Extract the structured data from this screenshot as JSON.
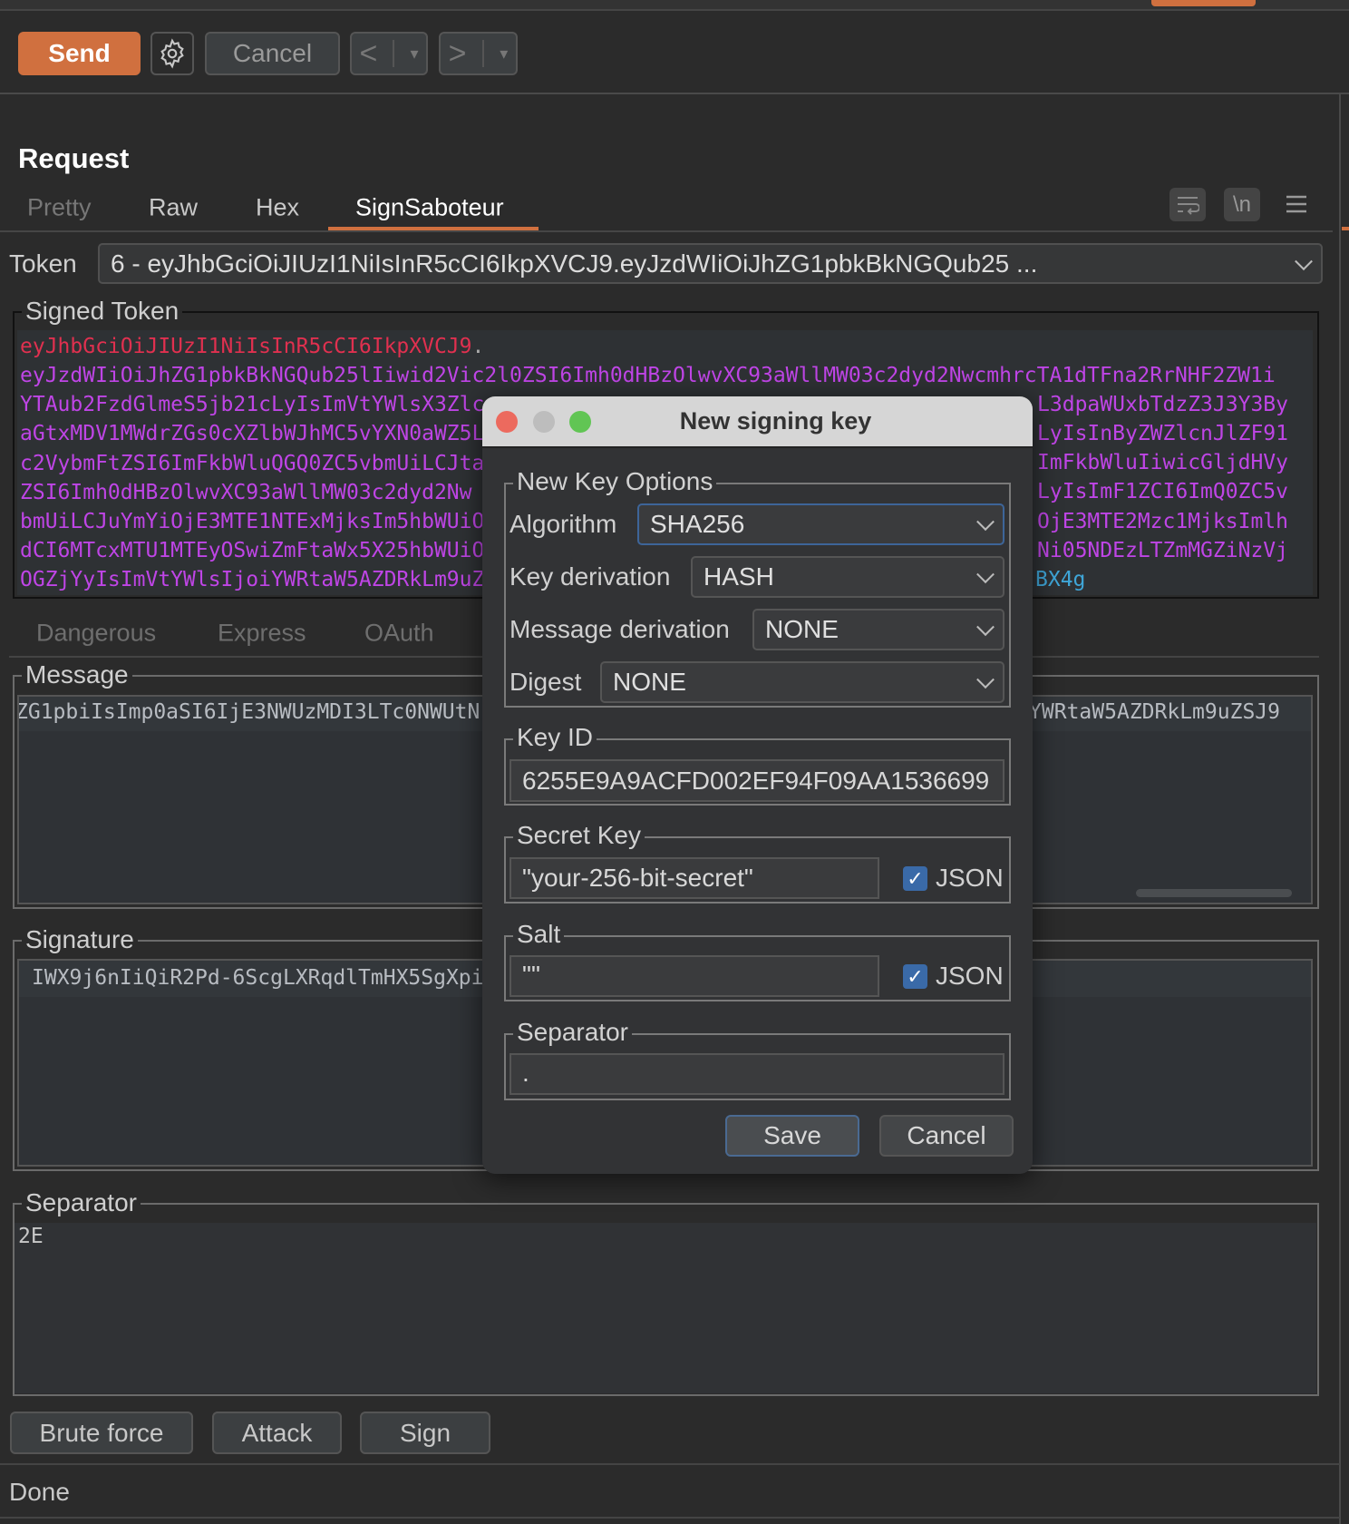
{
  "colors": {
    "accent": "#d0703f",
    "header": "#e0304f",
    "payload": "#bf45e6",
    "signature": "#3fa6d8"
  },
  "toolbar": {
    "send": "Send",
    "cancel": "Cancel",
    "back": "<",
    "forward": ">",
    "dropdown": "▾"
  },
  "request": {
    "title": "Request",
    "tabs": [
      "Pretty",
      "Raw",
      "Hex",
      "SignSaboteur"
    ],
    "active_tab": "SignSaboteur",
    "icons": {
      "wrap": "wrap-icon",
      "newline": "\\n",
      "menu": "menu-icon"
    }
  },
  "token": {
    "label": "Token",
    "value": "6 - eyJhbGciOiJIUzI1NiIsInR5cCI6IkpXVCJ9.eyJzdWIiOiJhZG1pbkBkNGQub25 ..."
  },
  "signed_token": {
    "legend": "Signed Token",
    "line1": "eyJhbGciOiJIUzI1NiIsInR5cCI6IkpXVCJ9",
    "dot": ".",
    "line2": "eyJzdWIiOiJhZG1pbkBkNGQub25lIiwid2Vic2l0ZSI6Imh0dHBzOlwvXC93aWllMW03c2dyd2NwcmhrcTA1dTFna2RrNHF2ZW1i",
    "left": [
      "YTAub2FzdGlmeS5jb21cLyIsImVtYWlsX3Zlc",
      "aGtxMDV1MWdrZGs0cXZlbWJhMC5vYXN0aWZ5L",
      "c2VybmFtZSI6ImFkbWluQGQ0ZC5vbmUiLCJta",
      "ZSI6Imh0dHBzOlwvXC93aWllMW03c2dyd2Nw",
      "bmUiLCJuYmYiOjE3MTE1NTExMjksIm5hbWUiO",
      "dCI6MTcxMTU1MTEyOSwiZmFtaWx5X25hbWUiO",
      "OGZjYyIsImVtYWlsIjoiYWRtaW5AZDRkLm9uZ"
    ],
    "right": [
      "L3dpaWUxbTdzZ3J3Y3By",
      "LyIsInByZWZlcnJlZF91",
      "ImFkbWluIiwicGljdHVy",
      "LyIsImF1ZCI6ImQ0ZC5v",
      "OjE3MTE2Mzc1MjksImlh",
      "Ni05NDEzLTZmMGZiNzVj"
    ],
    "signature_tail": "BX4g"
  },
  "lib_tabs": [
    "Dangerous",
    "Express",
    "OAuth"
  ],
  "message": {
    "legend": "Message",
    "left": "ZG1pbiIsImp0aSI6IjE3NWUzMDI3LTc0NWUtN",
    "right": "YWRtaW5AZDRkLm9uZSJ9"
  },
  "signature": {
    "legend": "Signature",
    "value": "IWX9j6nIiQiR2Pd-6ScgLXRqdlTmHX5SgXpi"
  },
  "separator": {
    "legend": "Separator",
    "value": "2E"
  },
  "actions": {
    "brute_force": "Brute force",
    "attack": "Attack",
    "sign": "Sign"
  },
  "status": "Done",
  "dialog": {
    "title": "New signing key",
    "options_legend": "New Key Options",
    "algorithm_label": "Algorithm",
    "algorithm": "SHA256",
    "key_derivation_label": "Key derivation",
    "key_derivation": "HASH",
    "message_derivation_label": "Message derivation",
    "message_derivation": "NONE",
    "digest_label": "Digest",
    "digest": "NONE",
    "key_id_legend": "Key ID",
    "key_id": "6255E9A9ACFD002EF94F09AA1536699",
    "secret_legend": "Secret Key",
    "secret": "\"your-256-bit-secret\"",
    "secret_json": true,
    "json_label": "JSON",
    "salt_legend": "Salt",
    "salt": "\"\"",
    "salt_json": true,
    "separator_legend": "Separator",
    "separator": ".",
    "save": "Save",
    "cancel": "Cancel"
  }
}
